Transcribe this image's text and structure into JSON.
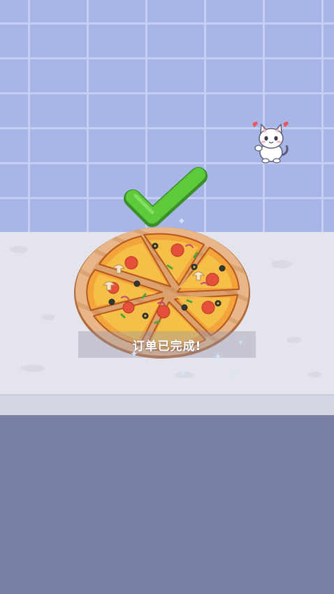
{
  "status": {
    "order_complete": "订单已完成!"
  },
  "icons": {
    "check": "checkmark-icon",
    "mascot": "cat-mascot-icon",
    "hearts": "heart-icon"
  },
  "colors": {
    "wall": "#a7b6e6",
    "counter": "#e4e4ec",
    "floor": "#7a7fa6",
    "check": "#5ec93a",
    "crust": "#f0a43a",
    "sauce": "#e4503a"
  }
}
